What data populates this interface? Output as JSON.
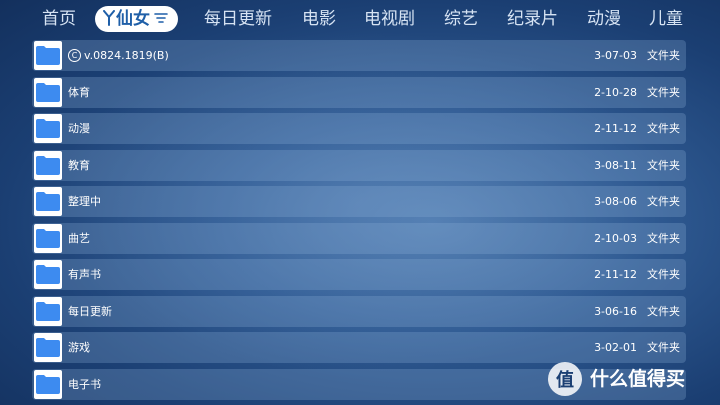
{
  "nav": {
    "tabs": [
      {
        "label": "首页"
      },
      {
        "label": "仙女",
        "active": true
      },
      {
        "label": "每日更新"
      },
      {
        "label": "电影"
      },
      {
        "label": "电视剧"
      },
      {
        "label": "综艺"
      },
      {
        "label": "纪录片"
      },
      {
        "label": "动漫"
      },
      {
        "label": "儿童"
      }
    ]
  },
  "files": [
    {
      "name": "v.0824.1819(B)",
      "date": "3-07-03",
      "type": "文件夹",
      "icon": "folder-icon",
      "prefix_icon": "copyright-icon"
    },
    {
      "name": "体育",
      "date": "2-10-28",
      "type": "文件夹",
      "icon": "folder-icon"
    },
    {
      "name": "动漫",
      "date": "2-11-12",
      "type": "文件夹",
      "icon": "folder-icon"
    },
    {
      "name": "教育",
      "date": "3-08-11",
      "type": "文件夹",
      "icon": "folder-icon"
    },
    {
      "name": "整理中",
      "date": "3-08-06",
      "type": "文件夹",
      "icon": "folder-icon"
    },
    {
      "name": "曲艺",
      "date": "2-10-03",
      "type": "文件夹",
      "icon": "folder-icon"
    },
    {
      "name": "有声书",
      "date": "2-11-12",
      "type": "文件夹",
      "icon": "folder-icon"
    },
    {
      "name": "每日更新",
      "date": "3-06-16",
      "type": "文件夹",
      "icon": "folder-icon"
    },
    {
      "name": "游戏",
      "date": "3-02-01",
      "type": "文件夹",
      "icon": "folder-icon"
    },
    {
      "name": "电子书",
      "date": "",
      "type": "",
      "icon": "folder-icon"
    }
  ],
  "watermark": {
    "text": "什么值得买",
    "badge_char": "值"
  },
  "colors": {
    "accent": "#1f5fa8",
    "folder": "#3d8bf0",
    "row_bg": "rgba(140,175,215,0.28)"
  }
}
